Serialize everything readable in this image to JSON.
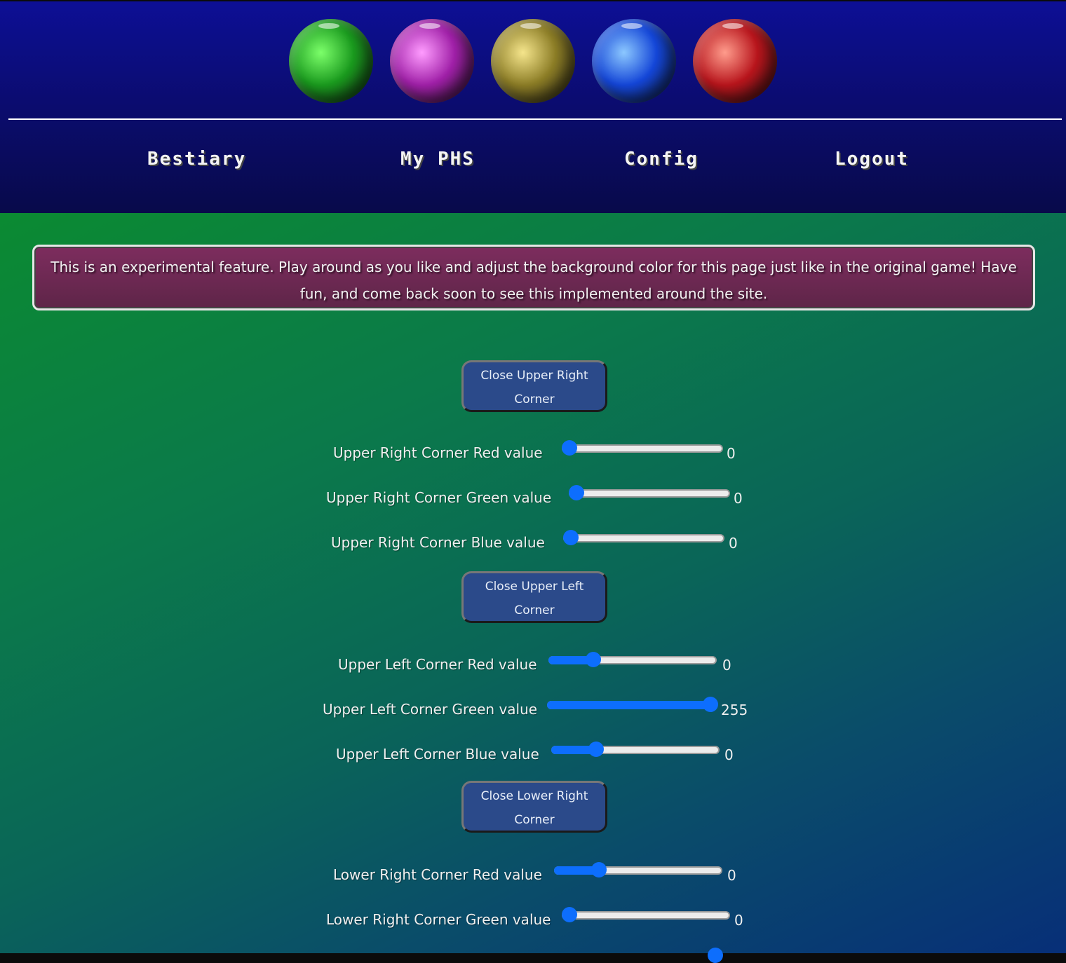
{
  "header": {
    "stones": [
      {
        "name": "green-stone",
        "color": "#1a9a1e",
        "highlight": "#7cff6a"
      },
      {
        "name": "purple-stone",
        "color": "#a020a8",
        "highlight": "#ff9cff"
      },
      {
        "name": "yellow-stone",
        "color": "#8c7d26",
        "highlight": "#f5e58c"
      },
      {
        "name": "blue-stone",
        "color": "#1446d8",
        "highlight": "#8cc8ff"
      },
      {
        "name": "red-stone",
        "color": "#b8151c",
        "highlight": "#ff9c8c"
      }
    ],
    "nav": [
      {
        "label": "Bestiary"
      },
      {
        "label": "My PHS"
      },
      {
        "label": "Config"
      },
      {
        "label": "Logout"
      }
    ]
  },
  "notice": {
    "text": "This is an experimental feature. Play around as you like and adjust the background color for this page just like in the original game! Have fun, and come back soon to see this implemented around the site."
  },
  "sections": [
    {
      "button_label": "Close Upper Right Corner",
      "sliders": [
        {
          "label": "Upper Right Corner Red value",
          "value": "0",
          "position": 0.0
        },
        {
          "label": "Upper Right Corner Green value",
          "value": "0",
          "position": 0.0
        },
        {
          "label": "Upper Right Corner Blue value",
          "value": "0",
          "position": 0.0
        }
      ]
    },
    {
      "button_label": "Close Upper Left Corner",
      "sliders": [
        {
          "label": "Upper Left Corner Red value",
          "value": "0",
          "position": 0.24
        },
        {
          "label": "Upper Left Corner Green value",
          "value": "255",
          "position": 1.0
        },
        {
          "label": "Upper Left Corner Blue value",
          "value": "0",
          "position": 0.24
        }
      ]
    },
    {
      "button_label": "Close Lower Right Corner",
      "sliders": [
        {
          "label": "Lower Right Corner Red value",
          "value": "0",
          "position": 0.24
        },
        {
          "label": "Lower Right Corner Green value",
          "value": "0",
          "position": 0.0
        }
      ]
    }
  ],
  "colors": {
    "accent": "#0d6efd",
    "notice_bg": "#6e2a55",
    "button_bg": "#2b4a8a"
  }
}
